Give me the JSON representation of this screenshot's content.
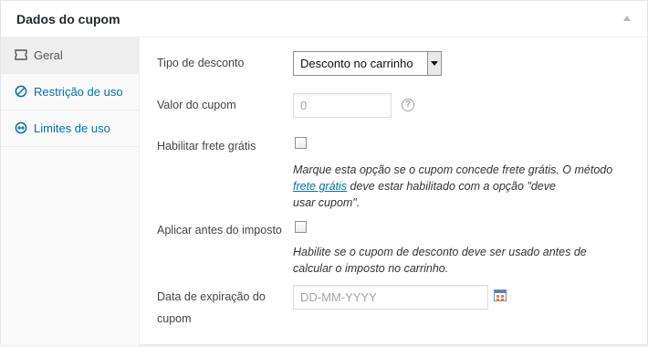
{
  "panel": {
    "title": "Dados do cupom"
  },
  "tabs": [
    {
      "label": "Geral",
      "icon": "ticket-icon",
      "active": true
    },
    {
      "label": "Restrição de uso",
      "icon": "prohibited-icon",
      "active": false
    },
    {
      "label": "Limites de uso",
      "icon": "limit-icon",
      "active": false
    }
  ],
  "fields": {
    "discount_type": {
      "label": "Tipo de desconto",
      "value": "Desconto no carrinho"
    },
    "coupon_amount": {
      "label": "Valor do cupom",
      "value": "",
      "placeholder": "0",
      "help": "?"
    },
    "free_shipping": {
      "label": "Habilitar frete grátis",
      "checked": false,
      "desc_before": "Marque esta opção se o cupom concede frete grátis. O método",
      "desc_link": "frete grátis",
      "desc_after_1": " deve estar habilitado com a opção \"deve",
      "desc_after_2": "usar cupom\"."
    },
    "apply_before_tax": {
      "label": "Aplicar antes do imposto",
      "checked": false,
      "desc_line_1": "Habilite se o cupom de desconto deve ser usado antes de",
      "desc_line_2": "calcular o  imposto no carrinho."
    },
    "expiry_date": {
      "label_line_1": "Data de expiração do",
      "label_line_2": "cupom",
      "value": "",
      "placeholder": "DD-MM-YYYY"
    }
  }
}
